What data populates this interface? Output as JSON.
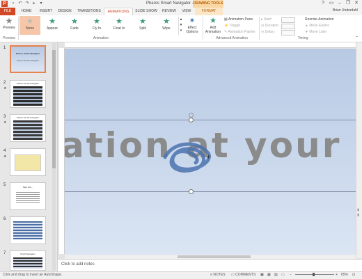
{
  "window": {
    "title": "Pharos Smart Navigator - PowerPoint",
    "contextual_tab_group": "DRAWING TOOLS",
    "app_icon": "P",
    "controls": [
      "?",
      "▭",
      "–",
      "❐",
      "✕"
    ]
  },
  "quick_access": [
    "save-icon",
    "undo-icon",
    "redo-icon",
    "slideshow-icon",
    "customize-icon"
  ],
  "tabs": [
    {
      "label": "FILE"
    },
    {
      "label": "HOME"
    },
    {
      "label": "INSERT"
    },
    {
      "label": "DESIGN"
    },
    {
      "label": "TRANSITIONS"
    },
    {
      "label": "ANIMATIONS"
    },
    {
      "label": "SLIDE SHOW"
    },
    {
      "label": "REVIEW"
    },
    {
      "label": "VIEW"
    },
    {
      "label": "FORMAT"
    }
  ],
  "active_tab": "ANIMATIONS",
  "user": {
    "name": "Brian Underdahl"
  },
  "ribbon": {
    "preview": {
      "label": "Preview",
      "group": "Preview"
    },
    "animations": {
      "group": "Animation",
      "items": [
        {
          "label": "None"
        },
        {
          "label": "Appear"
        },
        {
          "label": "Fade"
        },
        {
          "label": "Fly In"
        },
        {
          "label": "Float In"
        },
        {
          "label": "Split"
        },
        {
          "label": "Wipe"
        }
      ],
      "effect_options": "Effect Options"
    },
    "advanced": {
      "group": "Advanced Animation",
      "add_animation": "Add Animation",
      "animation_pane": "Animation Pane",
      "trigger": "Trigger",
      "animation_painter": "Animation Painter"
    },
    "timing": {
      "group": "Timing",
      "start": "Start:",
      "duration": "Duration:",
      "delay": "Delay:",
      "reorder": "Reorder Animation",
      "move_earlier": "Move Earlier",
      "move_later": "Move Later"
    }
  },
  "slides": [
    {
      "num": "1",
      "star": false,
      "title": "Pharos Smart Navigator",
      "subtitle": "Pharos Smart Navigator"
    },
    {
      "num": "2",
      "star": true,
      "title": "Pharos Smart Navigator",
      "subtitle": ""
    },
    {
      "num": "3",
      "star": false,
      "title": "Pharos Smart Navigator",
      "subtitle": ""
    },
    {
      "num": "4",
      "star": true,
      "title": "",
      "subtitle": ""
    },
    {
      "num": "5",
      "star": false,
      "title": "Step Into...",
      "subtitle": ""
    },
    {
      "num": "6",
      "star": false,
      "title": "",
      "subtitle": ""
    },
    {
      "num": "7",
      "star": false,
      "title": "Smart Navigator",
      "subtitle": ""
    }
  ],
  "selected_slide": 1,
  "slide": {
    "text": "ation at your fi"
  },
  "notes": {
    "placeholder": "Click to add notes"
  },
  "status": {
    "message": "Click and drag to insert an AutoShape.",
    "notes_label": "NOTES",
    "comments_label": "COMMENTS",
    "zoom": "65%"
  },
  "colors": {
    "accent": "#d24726",
    "slide_bg_top": "#b7c9e4",
    "slide_text": "#8b8b8b",
    "selected_anim_bg": "#f6c6a9",
    "drawing_tools": "#f9d7a4"
  }
}
